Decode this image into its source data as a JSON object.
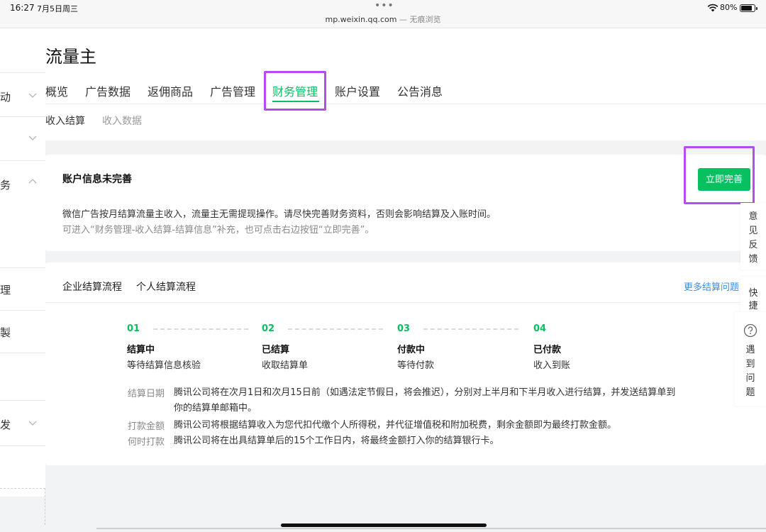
{
  "statusbar": {
    "time": "16:27",
    "date": "7月5日周三",
    "dots": "•••",
    "url": "mp.weixin.qq.com",
    "private_mode": " — 无痕浏览",
    "battery": "80%"
  },
  "sidebar": {
    "items": [
      {
        "label": "动"
      },
      {
        "label": "务"
      },
      {
        "label": "理"
      },
      {
        "label": "製"
      },
      {
        "label": "发"
      }
    ]
  },
  "page": {
    "title": "流量主"
  },
  "tabs": [
    {
      "label": "概览"
    },
    {
      "label": "广告数据"
    },
    {
      "label": "返佣商品"
    },
    {
      "label": "广告管理"
    },
    {
      "label": "财务管理"
    },
    {
      "label": "账户设置"
    },
    {
      "label": "公告消息"
    }
  ],
  "subtabs": [
    {
      "label": "收入结算"
    },
    {
      "label": "收入数据"
    }
  ],
  "notice_card": {
    "title": "账户信息未完善",
    "description": "微信广告按月结算流量主收入，流量主无需提现操作。请尽快完善财务资料，否则会影响结算及入账时间。",
    "hint": "可进入“财务管理-收入结算-结算信息”补充，也可点击右边按钮“立即完善”。",
    "button": "立即完善"
  },
  "process_card": {
    "tabs": [
      "企业结算流程",
      "个人结算流程"
    ],
    "more_link": "更多结算问题",
    "steps": [
      {
        "num": "01",
        "title": "结算中",
        "desc": "等待结算信息核验"
      },
      {
        "num": "02",
        "title": "已结算",
        "desc": "收取结算单"
      },
      {
        "num": "03",
        "title": "付款中",
        "desc": "等待付款"
      },
      {
        "num": "04",
        "title": "已付款",
        "desc": "收入到账"
      }
    ],
    "info": [
      {
        "label": "结算日期",
        "line1": "腾讯公司将在次月1日和次月15日前（如遇法定节假日，将会推迟），分别对上半月和下半月收入进行结算，并发送结算单到",
        "line2": "你的结算单邮箱中。"
      },
      {
        "label": "打款金额",
        "line1": "腾讯公司将根据结算收入为您代扣代缴个人所得税，并代征增值税和附加税费，剩余金额即为最终打款金额。"
      },
      {
        "label": "何时打款",
        "line1": "腾讯公司将在出具结算单后的15个工作日内，将最终金额打入你的结算银行卡。"
      }
    ]
  },
  "floating": {
    "feedback": [
      "意",
      "见",
      "反",
      "馈"
    ],
    "shortcut": [
      "快",
      "捷"
    ],
    "help": [
      "遇",
      "到",
      "问",
      "题"
    ]
  },
  "colors": {
    "accent": "#07c160",
    "link": "#3a8ee6",
    "annotation": "#b54cf0"
  }
}
